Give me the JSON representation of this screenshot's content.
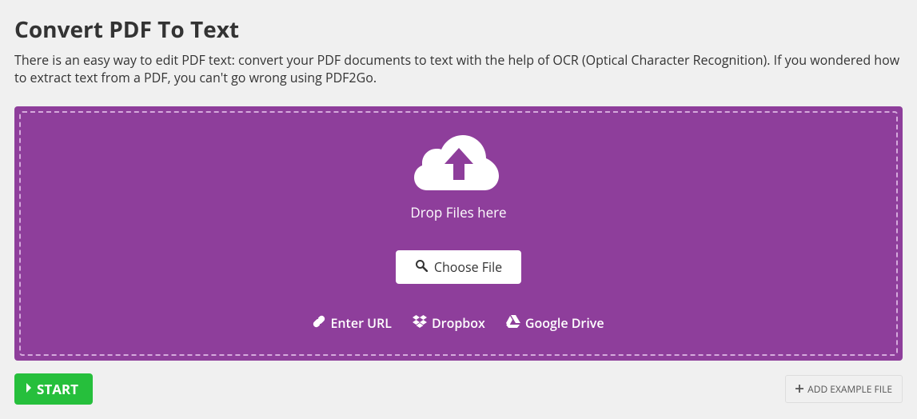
{
  "header": {
    "title": "Convert PDF To Text",
    "description": "There is an easy way to edit PDF text: convert your PDF documents to text with the help of OCR (Optical Character Recognition). If you wondered how to extract text from a PDF, you can't go wrong using PDF2Go."
  },
  "dropzone": {
    "drop_text": "Drop Files here",
    "choose_file_label": "Choose File",
    "sources": {
      "url": "Enter URL",
      "dropbox": "Dropbox",
      "gdrive": "Google Drive"
    }
  },
  "actions": {
    "start_label": "START",
    "add_example_label": "ADD EXAMPLE FILE"
  },
  "colors": {
    "dropzone_bg": "#8e3e9b",
    "start_bg": "#26bf3c"
  }
}
